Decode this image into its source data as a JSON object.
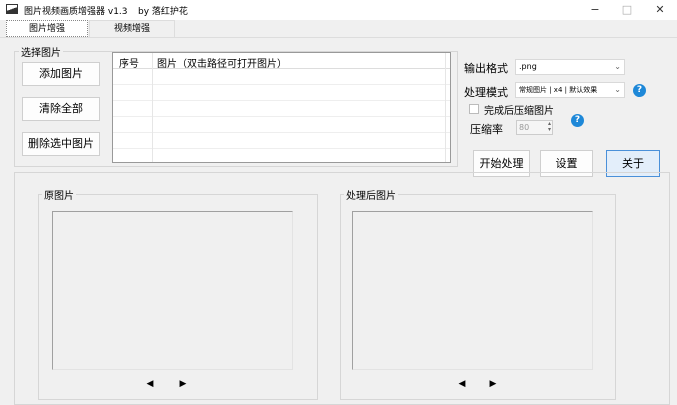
{
  "window": {
    "title": "图片视频画质增强器 v1.3",
    "author": "by 落红护花",
    "minimize": "−",
    "maximize": "□",
    "close": "✕"
  },
  "tabs": [
    {
      "label": "图片增强"
    },
    {
      "label": "视频增强"
    }
  ],
  "select_group": {
    "legend": "选择图片",
    "add": "添加图片",
    "clear": "清除全部",
    "delete": "删除选中图片",
    "columns": [
      "序号",
      "图片（双击路径可打开图片）"
    ]
  },
  "settings": {
    "format_label": "输出格式",
    "format_value": ".png",
    "mode_label": "处理模式",
    "mode_value": "常规图片 | x4 | 默认效果",
    "compress_checkbox": "完成后压缩图片",
    "compress_label": "压缩率",
    "compress_value": "80",
    "help": "?"
  },
  "actions": {
    "start": "开始处理",
    "settings": "设置",
    "about": "关于"
  },
  "preview": {
    "original": "原图片",
    "processed": "处理后图片",
    "prev": "◀",
    "next": "▶"
  }
}
